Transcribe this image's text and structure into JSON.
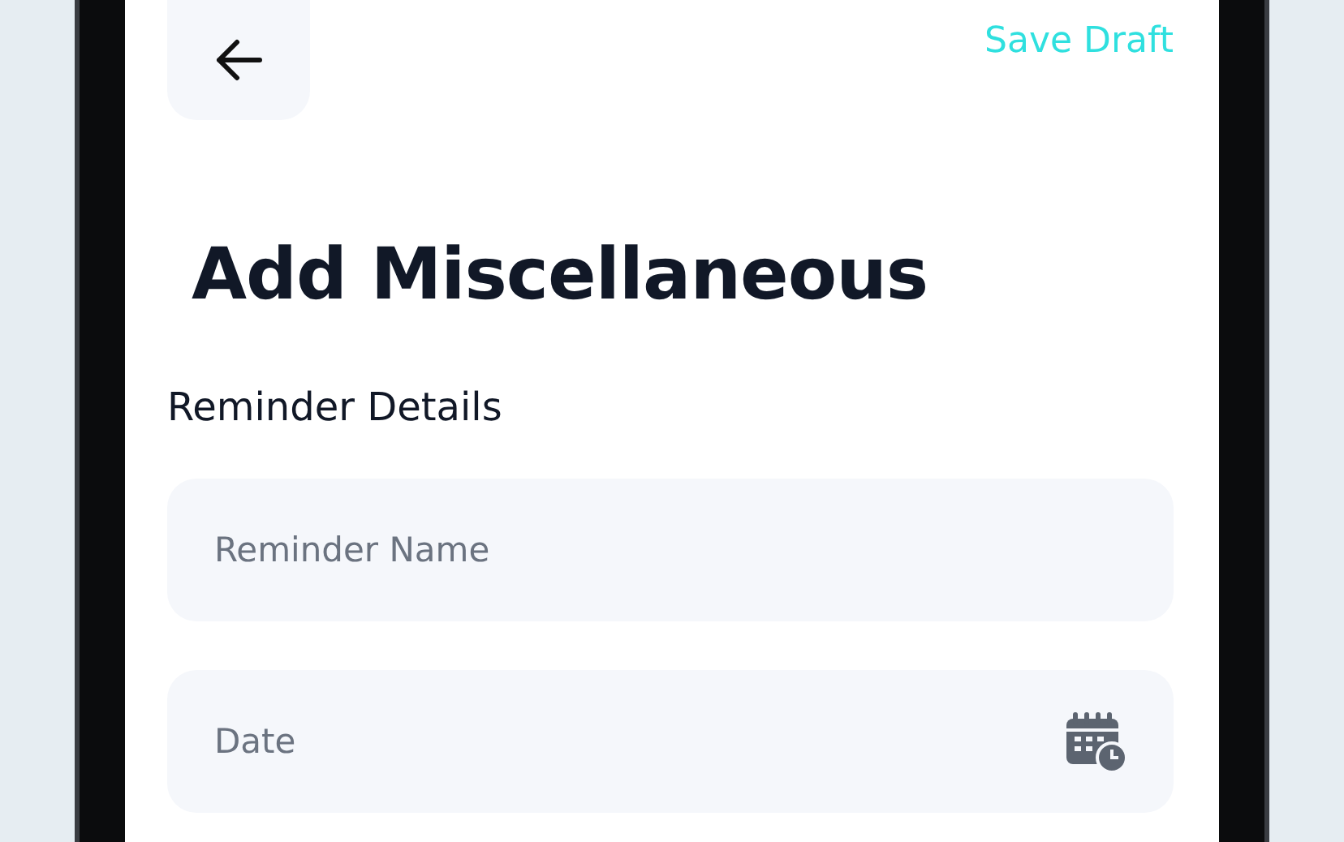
{
  "header": {
    "action": "Save Draft"
  },
  "title": "Add Miscellaneous",
  "section": "Reminder Details",
  "fields": [
    {
      "kind": "text",
      "placeholder": "Reminder Name"
    },
    {
      "kind": "date",
      "placeholder": "Date"
    }
  ]
}
